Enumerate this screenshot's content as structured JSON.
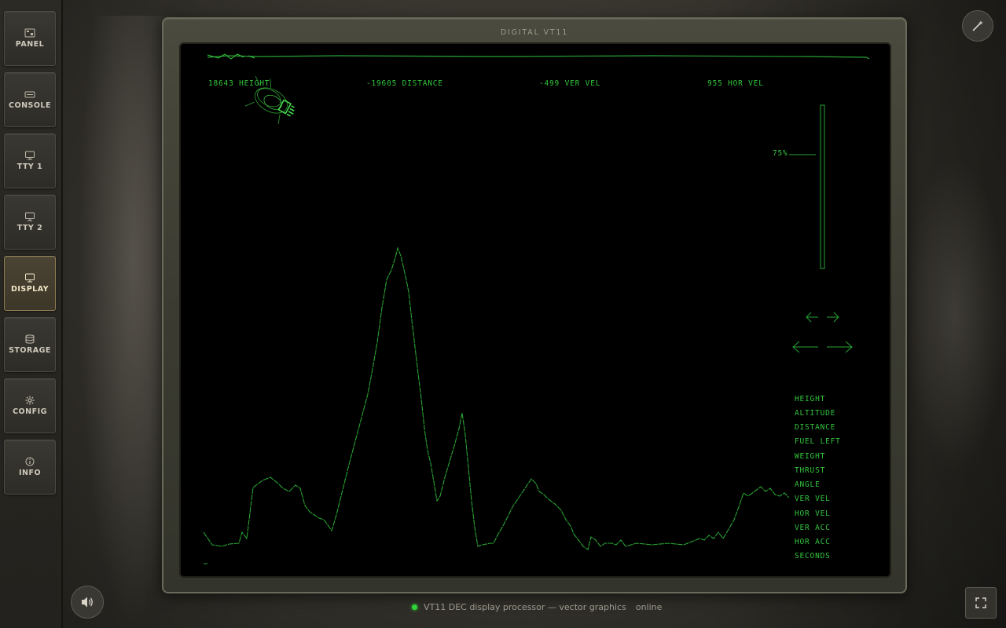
{
  "colors": {
    "phosphor": "#33c43d",
    "active_border": "#8e7d52",
    "online": "#2fd538"
  },
  "sidebar": {
    "items": [
      {
        "label": "PANEL",
        "icon": "panel-icon",
        "active": false
      },
      {
        "label": "CONSOLE",
        "icon": "console-icon",
        "active": false
      },
      {
        "label": "TTY 1",
        "icon": "monitor-icon",
        "active": false
      },
      {
        "label": "TTY 2",
        "icon": "monitor-icon",
        "active": false
      },
      {
        "label": "DISPLAY",
        "icon": "monitor-icon",
        "active": true
      },
      {
        "label": "STORAGE",
        "icon": "database-icon",
        "active": false
      },
      {
        "label": "CONFIG",
        "icon": "gear-icon",
        "active": false
      },
      {
        "label": "INFO",
        "icon": "info-icon",
        "active": false
      }
    ]
  },
  "monitor": {
    "title": "DIGITAL VT11"
  },
  "vt11": {
    "readouts": {
      "height": "18643 HEIGHT",
      "distance": "-19605 DISTANCE",
      "ver_vel": "-499 VER VEL",
      "hor_vel": "955 HOR VEL"
    },
    "throttle_label": "75%",
    "throttle_level_percent": 75,
    "menu": [
      "HEIGHT",
      "ALTITUDE",
      "DISTANCE",
      "FUEL LEFT",
      "WEIGHT",
      "THRUST",
      "ANGLE",
      "VER VEL",
      "HOR VEL",
      "VER ACC",
      "HOR ACC",
      "SECONDS"
    ]
  },
  "status": {
    "text": "VT11 DEC display processor — vector graphics",
    "state": "online"
  },
  "icons": {
    "wand": "magic-wand-icon",
    "sound": "speaker-icon",
    "fullscreen": "fullscreen-icon",
    "pause": "pause-icon"
  }
}
